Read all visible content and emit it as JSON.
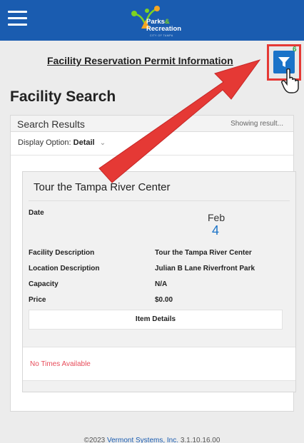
{
  "header": {
    "menu_icon": "hamburger-menu-icon",
    "logo_line1": "Parks",
    "logo_amp": "&",
    "logo_line2": "Recreation",
    "logo_sub": "CITY OF TAMPA",
    "brand_color": "#1a5cb0"
  },
  "permit_link": "Facility Reservation Permit Information",
  "filter": {
    "icon": "filter-funnel-icon",
    "count": "6",
    "highlight_color": "#e53935"
  },
  "page_title": "Facility Search",
  "results": {
    "title": "Search Results",
    "showing": "Showing result...",
    "display_option_label": "Display Option:",
    "display_option_value": "Detail",
    "card": {
      "title": "Tour the Tampa River Center",
      "date_label": "Date",
      "date_month": "Feb",
      "date_day": "4",
      "rows": [
        {
          "label": "Facility Description",
          "value": "Tour the Tampa River Center"
        },
        {
          "label": "Location Description",
          "value": "Julian B Lane Riverfront Park"
        },
        {
          "label": "Capacity",
          "value": "N/A"
        },
        {
          "label": "Price",
          "value": "$0.00"
        }
      ],
      "item_details_button": "Item Details",
      "no_times": "No Times Available"
    }
  },
  "footer": {
    "prefix": "©2023",
    "company": "Vermont Systems, Inc.",
    "version": "3.1.10.16.00"
  }
}
